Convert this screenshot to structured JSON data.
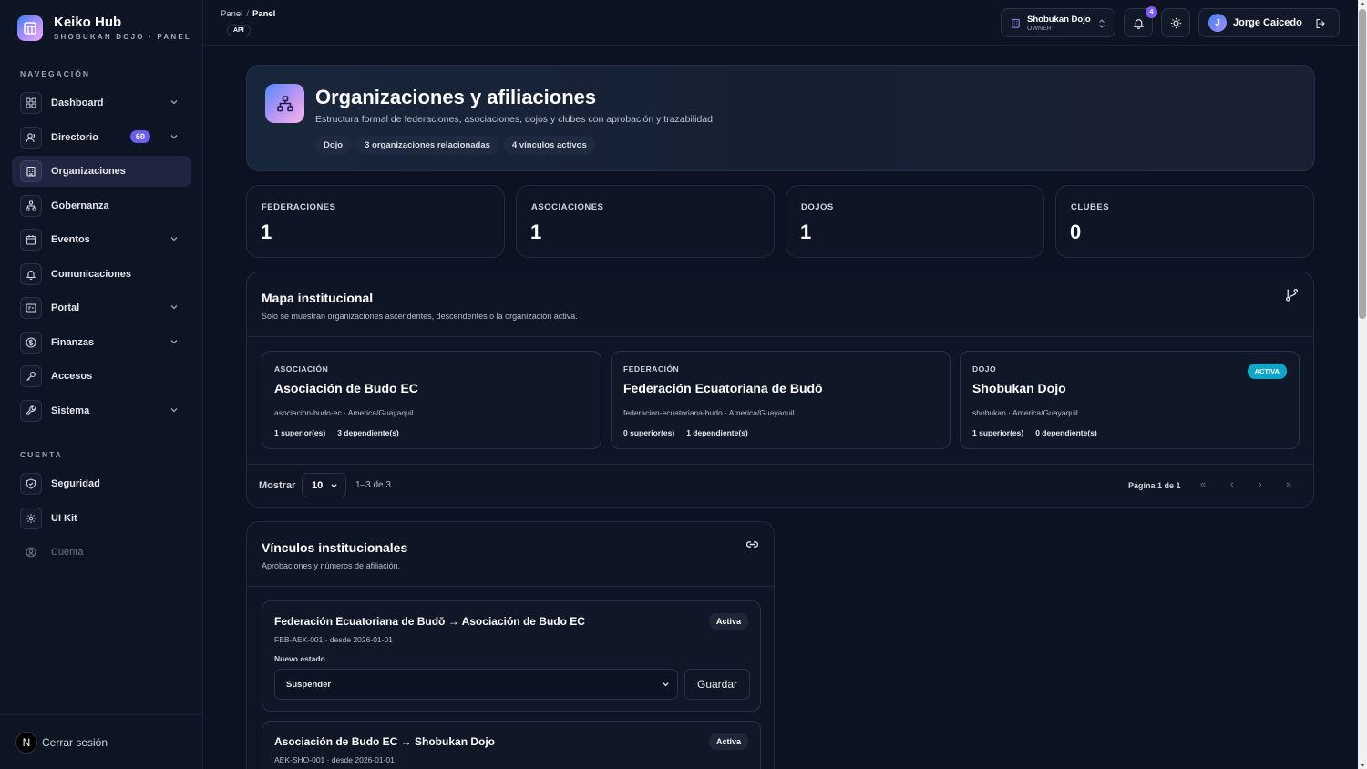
{
  "app": {
    "name": "Keiko Hub",
    "subtitle": "SHOBUKAN DOJO · PANEL"
  },
  "sidebar": {
    "nav_label": "NAVEGACIÓN",
    "account_label": "CUENTA",
    "nav_items": [
      {
        "label": "Dashboard"
      },
      {
        "label": "Directorio",
        "badge": "60"
      },
      {
        "label": "Organizaciones"
      },
      {
        "label": "Gobernanza"
      },
      {
        "label": "Eventos"
      },
      {
        "label": "Comunicaciones"
      },
      {
        "label": "Portal"
      },
      {
        "label": "Finanzas"
      },
      {
        "label": "Accesos"
      },
      {
        "label": "Sistema"
      }
    ],
    "account_items": [
      {
        "label": "Seguridad"
      },
      {
        "label": "UI Kit"
      },
      {
        "label": "Cuenta"
      }
    ],
    "logout_letter": "N",
    "logout_label": "Cerrar sesión"
  },
  "topbar": {
    "breadcrumb": [
      "Panel",
      "Panel"
    ],
    "breadcrumb_sep": "/",
    "api_badge": "API",
    "tenant_name": "Shobukan Dojo",
    "tenant_role": "OWNER",
    "notification_count": "4",
    "user_initial": "J",
    "user_name": "Jorge Caicedo"
  },
  "hero": {
    "title": "Organizaciones y afiliaciones",
    "subtitle": "Estructura formal de federaciones, asociaciones, dojos y clubes con aprobación y trazabilidad.",
    "tags": [
      "Dojo",
      "3 organizaciones relacionadas",
      "4 vínculos activos"
    ]
  },
  "stats": [
    {
      "label": "FEDERACIONES",
      "value": "1"
    },
    {
      "label": "ASOCIACIONES",
      "value": "1"
    },
    {
      "label": "DOJOS",
      "value": "1"
    },
    {
      "label": "CLUBES",
      "value": "0"
    }
  ],
  "map": {
    "title": "Mapa institucional",
    "subtitle": "Solo se muestran organizaciones ascendentes, descendentes o la organización activa.",
    "orgs": [
      {
        "type": "ASOCIACIÓN",
        "name": "Asociación de Budo EC",
        "meta": "asociacion-budo-ec · America/Guayaquil",
        "superiors": "1 superior(es)",
        "dependents": "3 dependiente(s)"
      },
      {
        "type": "FEDERACIÓN",
        "name": "Federación Ecuatoriana de Budō",
        "meta": "federacion-ecuatoriana-budo · America/Guayaquil",
        "superiors": "0 superior(es)",
        "dependents": "1 dependiente(s)"
      },
      {
        "type": "DOJO",
        "name": "Shobukan Dojo",
        "meta": "shobukan · America/Guayaquil",
        "superiors": "1 superior(es)",
        "dependents": "0 dependiente(s)",
        "status": "ACTIVA"
      }
    ],
    "pagination": {
      "show_label": "Mostrar",
      "page_size": "10",
      "range": "1–3 de 3",
      "page_info": "Página 1 de 1",
      "first": "«",
      "prev": "‹",
      "next": "›",
      "last": "»"
    }
  },
  "links": {
    "title": "Vínculos institucionales",
    "subtitle": "Aprobaciones y números de afiliación.",
    "items": [
      {
        "title": "Federación Ecuatoriana de Budō → Asociación de Budo EC",
        "meta": "FEB-AEK-001 · desde 2026-01-01",
        "status": "Activa",
        "field_label": "Nuevo estado",
        "selected": "Suspender",
        "save": "Guardar"
      },
      {
        "title": "Asociación de Budo EC → Shobukan Dojo",
        "meta": "AEK-SHO-001 · desde 2026-01-01",
        "status": "Activa"
      }
    ]
  },
  "colors": {
    "accent": "#6d5df0",
    "active_pill": "#0ea5c6",
    "background": "#0c1222"
  }
}
